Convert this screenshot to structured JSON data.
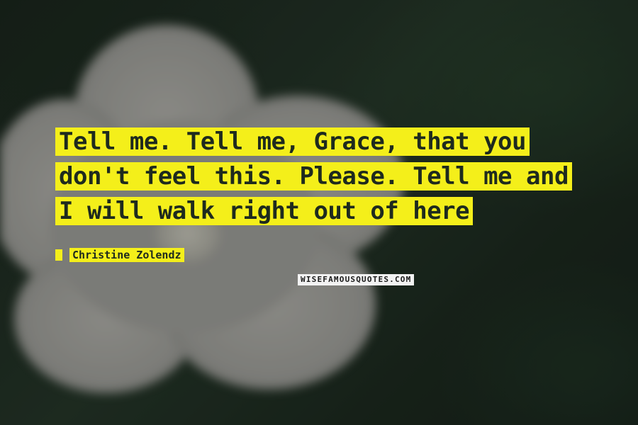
{
  "quote": {
    "text": "Tell me. Tell me, Grace, that you don't feel this. Please. Tell me and I will walk right out of here",
    "author": "Christine Zolendz",
    "highlight_color": "#f4ef1a",
    "text_color": "#1e2a1e"
  },
  "watermark": {
    "text": "WISEFAMOUSQUOTES.COM"
  },
  "background": {
    "subject": "blurred white flower",
    "base_color": "#1e2820"
  }
}
